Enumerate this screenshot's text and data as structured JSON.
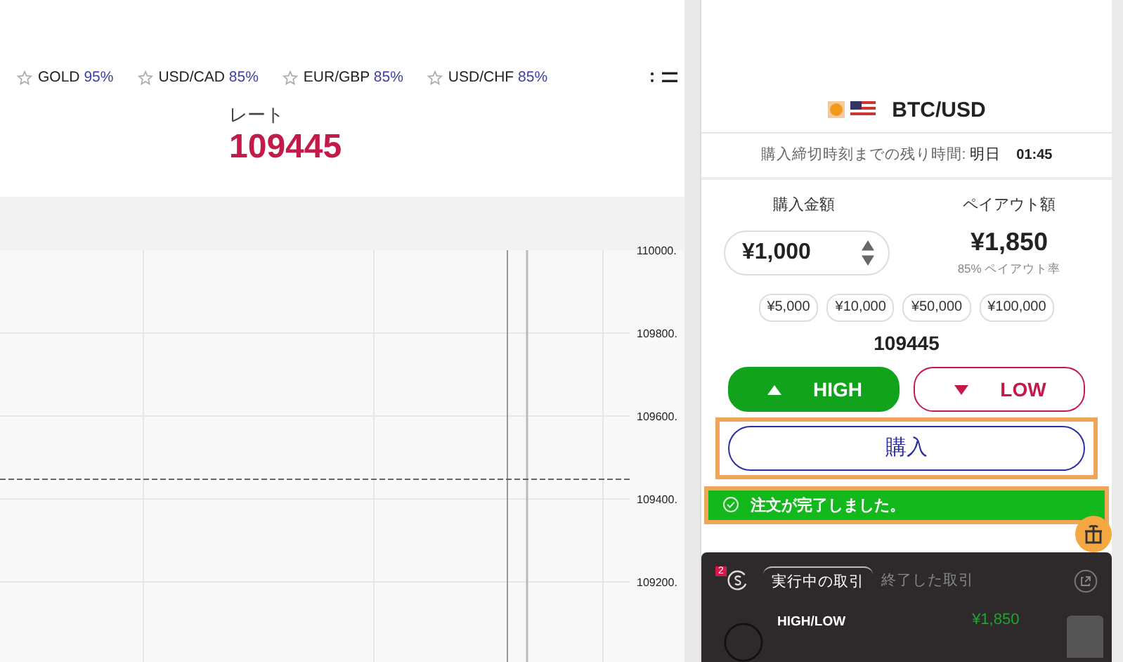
{
  "favorites": [
    {
      "symbol": "GOLD",
      "payout": "95%"
    },
    {
      "symbol": "USD/CAD",
      "payout": "85%"
    },
    {
      "symbol": "EUR/GBP",
      "payout": "85%"
    },
    {
      "symbol": "USD/CHF",
      "payout": "85%"
    }
  ],
  "rate": {
    "label": "レート",
    "value": "109445"
  },
  "chart": {
    "axis_labels": [
      "110000.",
      "109800.",
      "109600.",
      "109400.",
      "109200."
    ]
  },
  "trade_panel": {
    "pair": "BTC/USD",
    "deadline_label": "購入締切時刻までの残り時間:",
    "deadline_day": "明日",
    "deadline_time": "01:45",
    "amount_label": "購入金額",
    "amount": "¥1,000",
    "payout_label": "ペイアウト額",
    "payout": "¥1,850",
    "payout_rate": "85% ペイアウト率",
    "presets": [
      "¥5,000",
      "¥10,000",
      "¥50,000",
      "¥100,000"
    ],
    "current_rate": "109445",
    "directions": [
      {
        "kind": "high",
        "label": "HIGH",
        "selected": true
      },
      {
        "kind": "low",
        "label": "LOW",
        "selected": false
      }
    ],
    "purchase": {
      "label": "購入",
      "highlighted": true
    },
    "notification": {
      "text": "注文が完了しました。",
      "highlighted": true
    }
  },
  "trades": {
    "count": "2",
    "tabs": [
      {
        "label": "実行中の取引",
        "selected": true
      },
      {
        "label": "終了した取引",
        "selected": false
      }
    ],
    "rows": [
      {
        "type": "HIGH/LOW",
        "payout": "¥1,850"
      }
    ]
  }
}
